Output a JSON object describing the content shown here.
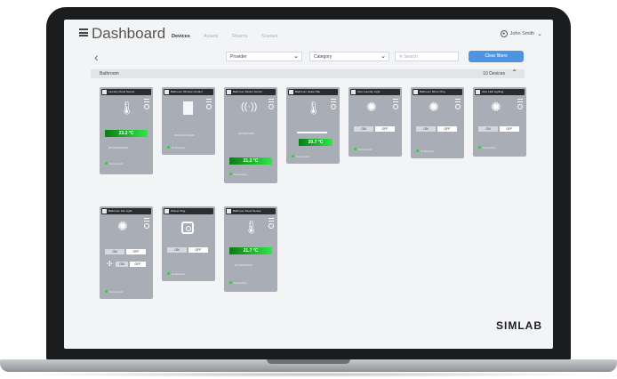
{
  "header": {
    "title": "Dashboard",
    "tabs": [
      "Devices",
      "Assets",
      "Rooms",
      "Scenes"
    ],
    "user": "John Smith"
  },
  "filters": {
    "provider": "Provider",
    "category": "Category",
    "search_placeholder": "Search",
    "clear_label": "Clear filters"
  },
  "group": {
    "name": "Bathroom",
    "count": "10 Devices"
  },
  "cards": [
    {
      "label": "Laundry Flood Sensor",
      "temp": "23.2 °C",
      "status": "NO MOVEMENT",
      "conn": "Connected"
    },
    {
      "label": "Bathroom Window Contact",
      "status": "DOOR CLOSED",
      "conn": "Connected"
    },
    {
      "label": "Bathroom Motion Sensor",
      "status": "NO MOTION",
      "temp": "21.2 °C",
      "conn": "Connected"
    },
    {
      "label": "Bathroom Heater Bar",
      "temp": "20.7 °C",
      "conn": "Connected"
    },
    {
      "label": "Glen Laundry Light",
      "on": "ON",
      "off": "OFF",
      "conn": "Connected"
    },
    {
      "label": "Bathroom Mirror Plug",
      "on": "ON",
      "off": "OFF",
      "conn": "Connected"
    },
    {
      "label": "Glen LED Lighting",
      "on": "ON",
      "off": "OFF",
      "conn": "Connected"
    },
    {
      "label": "Bathroom Fan Light",
      "on": "ON",
      "off": "OFF",
      "conn": "Connected"
    },
    {
      "label": "Shaver Plug",
      "on": "ON",
      "off": "OFF",
      "conn": "Connected"
    },
    {
      "label": "Bathroom Flood Sensor",
      "temp": "21.7 °C",
      "status": "NO WARNING",
      "conn": "Connected"
    }
  ],
  "brand": "SIMLAB"
}
